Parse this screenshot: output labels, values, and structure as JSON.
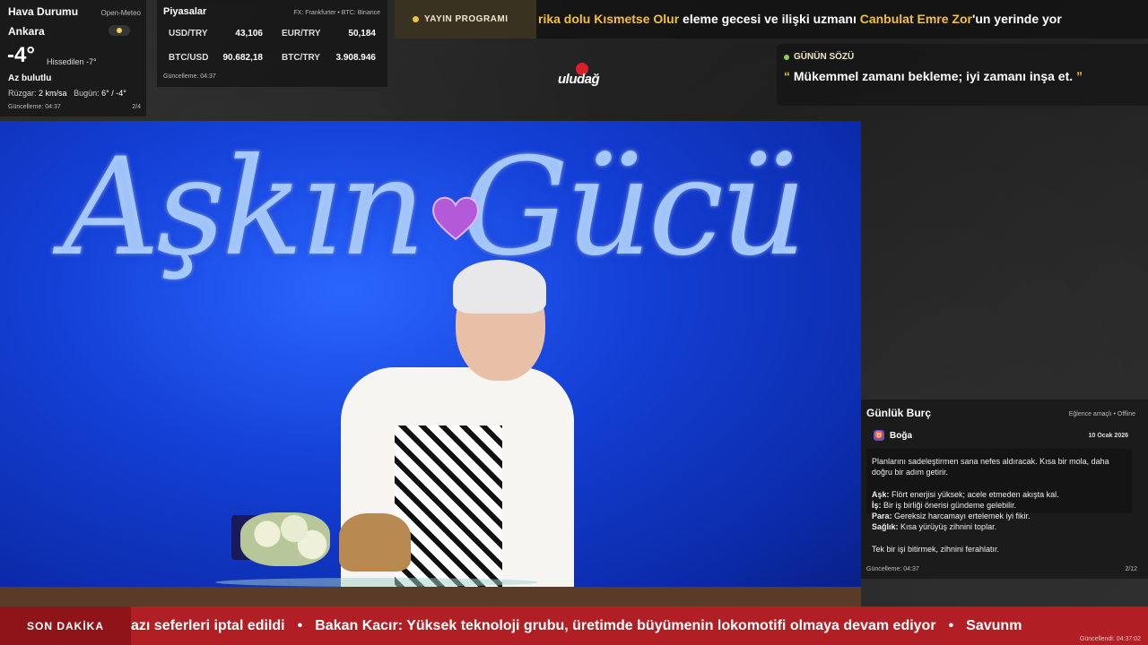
{
  "weather": {
    "title": "Hava Durumu",
    "source": "Open-Meteo",
    "city": "Ankara",
    "temperature": "-4°",
    "feels_like": "Hissedilen -7°",
    "condition": "Az bulutlu",
    "wind_label": "Rüzgar:",
    "wind_value": "2 km/sa",
    "today_label": "Bugün:",
    "today_value": "6° / -4°",
    "updated": "Güncelleme: 04:37",
    "page": "2/4",
    "icon": "partly-sunny-icon"
  },
  "markets": {
    "title": "Piyasalar",
    "source": "FX: Frankfurter • BTC: Binance",
    "rows": [
      {
        "key": "USD/TRY",
        "value": "43,106"
      },
      {
        "key": "EUR/TRY",
        "value": "50,184"
      },
      {
        "key": "BTC/USD",
        "value": "90.682,18"
      },
      {
        "key": "BTC/TRY",
        "value": "3.908.946"
      }
    ],
    "updated": "Güncelleme: 04:37"
  },
  "schedule": {
    "badge": "YAYIN PROGRAMI",
    "text_parts": [
      {
        "t": "rika dolu Kısmetse Olur",
        "hl": true
      },
      {
        "t": " eleme gecesi ve ilişki uzmanı ",
        "hl": false
      },
      {
        "t": "Canbulat Emre Zor",
        "hl": true
      },
      {
        "t": "'un yerinde yor",
        "hl": false
      }
    ]
  },
  "logo": {
    "text": "uludağ"
  },
  "quote": {
    "title": "GÜNÜN SÖZÜ",
    "open_mark": "“",
    "text": "Mükemmel zamanı bekleme; iyi zamanı inşa et.",
    "close_mark": "”"
  },
  "video": {
    "show_title": "Aşkın Gücü"
  },
  "horoscope": {
    "title": "Günlük Burç",
    "note": "Eğlence amaçlı • Offline",
    "sign": "Boğa",
    "sign_symbol": "♉",
    "date": "10 Ocak 2026",
    "intro": "Planlarını sadeleştirmen sana nefes aldıracak. Kısa bir mola, daha doğru bir adım getirir.",
    "lines": [
      {
        "label": "Aşk:",
        "text": " Flört enerjisi yüksek; acele etmeden akışta kal."
      },
      {
        "label": "İş:",
        "text": " Bir iş birliği önerisi gündeme gelebilir."
      },
      {
        "label": "Para:",
        "text": " Gereksiz harcamayı ertelemek iyi fikir."
      },
      {
        "label": "Sağlık:",
        "text": " Kısa yürüyüş zihnini toplar."
      }
    ],
    "tip": "Tek bir işi bitirmek, zihnini ferahlatır.",
    "updated": "Güncelleme: 04:37",
    "page": "2/12"
  },
  "ticker": {
    "badge": "SON DAKİKA",
    "items": [
      "azı seferleri iptal edildi",
      "Bakan Kacır: Yüksek teknoloji grubu, üretimde büyümenin lokomotifi olmaya devam ediyor",
      "Savunm"
    ],
    "separator": "•",
    "updated": "Güncellendi: 04:37:02"
  },
  "colors": {
    "accent": "#f1c232",
    "ticker_red": "#b11f25",
    "quote_dot": "#8fd14f"
  }
}
